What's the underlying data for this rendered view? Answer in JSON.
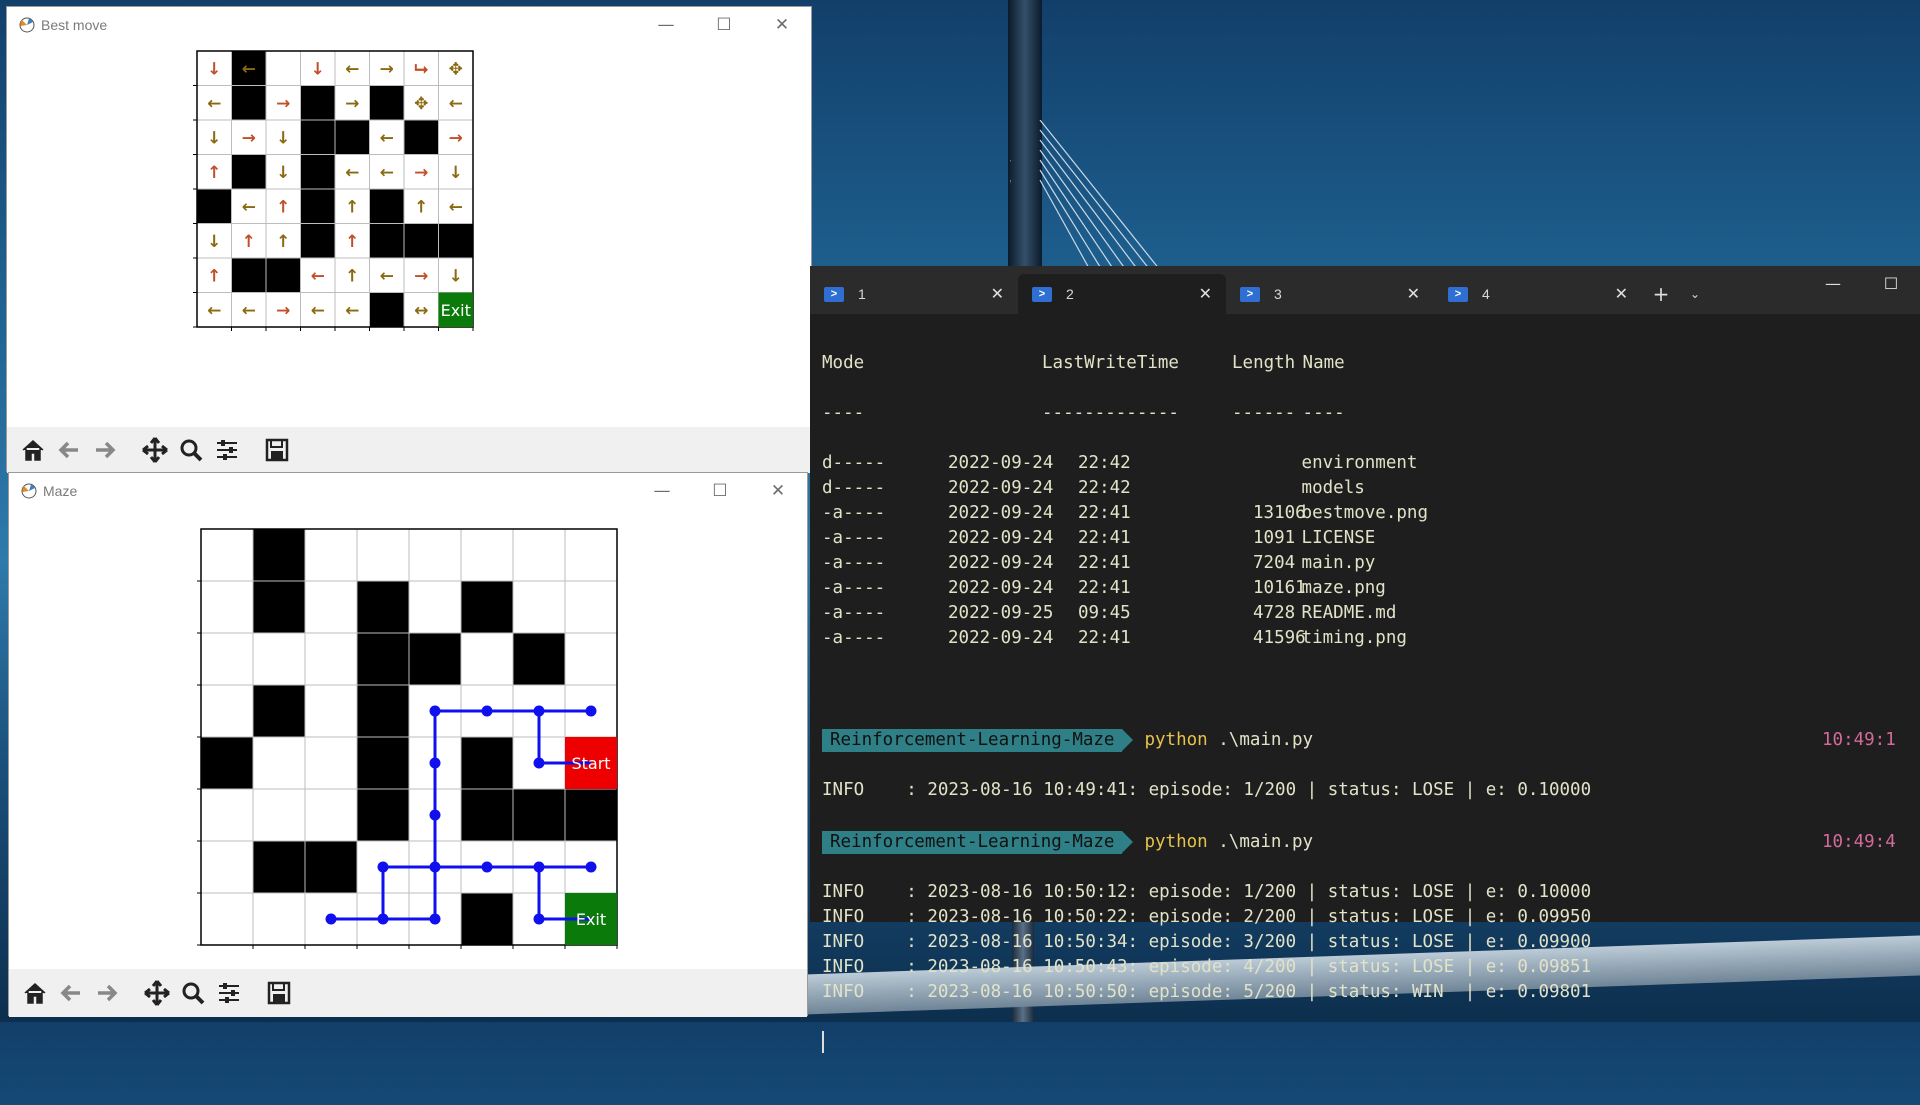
{
  "bestmove_window": {
    "title": "Best move",
    "exit_label": "Exit",
    "walls": [
      [
        0,
        1
      ],
      [
        1,
        1
      ],
      [
        1,
        3
      ],
      [
        1,
        5
      ],
      [
        2,
        3
      ],
      [
        2,
        4
      ],
      [
        2,
        6
      ],
      [
        3,
        1
      ],
      [
        3,
        3
      ],
      [
        4,
        0
      ],
      [
        4,
        3
      ],
      [
        4,
        5
      ],
      [
        5,
        3
      ],
      [
        5,
        5
      ],
      [
        5,
        6
      ],
      [
        5,
        7
      ],
      [
        6,
        1
      ],
      [
        6,
        2
      ],
      [
        7,
        5
      ]
    ],
    "arrows": [
      [
        "↓",
        "←",
        null,
        "↓",
        "←",
        "→",
        "⮡",
        "✥",
        "←"
      ],
      [
        "←",
        null,
        "→",
        null,
        "→",
        null,
        "✥",
        "←"
      ],
      [
        "↓",
        "→",
        "↓",
        null,
        null,
        "←",
        null,
        "→"
      ],
      [
        "↑",
        null,
        "↓",
        null,
        "←",
        "←",
        "→",
        "↓"
      ],
      [
        null,
        "←",
        "↑",
        null,
        "↑",
        null,
        "↑",
        "←"
      ],
      [
        "↓",
        "↑",
        "↑",
        null,
        "↑",
        null,
        null,
        null
      ],
      [
        "↑",
        null,
        null,
        "←",
        "↑",
        "←",
        "→",
        "↓"
      ],
      [
        "←",
        "←",
        "→",
        "←",
        "←",
        null,
        "↔",
        ""
      ]
    ]
  },
  "maze_window": {
    "title": "Maze",
    "start_label": "Start",
    "exit_label": "Exit",
    "walls": [
      [
        0,
        1
      ],
      [
        1,
        1
      ],
      [
        1,
        3
      ],
      [
        1,
        5
      ],
      [
        2,
        3
      ],
      [
        2,
        4
      ],
      [
        2,
        6
      ],
      [
        3,
        1
      ],
      [
        3,
        3
      ],
      [
        4,
        0
      ],
      [
        4,
        3
      ],
      [
        4,
        5
      ],
      [
        5,
        3
      ],
      [
        5,
        5
      ],
      [
        5,
        6
      ],
      [
        5,
        7
      ],
      [
        6,
        1
      ],
      [
        6,
        2
      ],
      [
        7,
        5
      ]
    ]
  },
  "toolbar": {
    "home_icon": "home-icon",
    "back_icon": "back-icon",
    "forward_icon": "forward-icon",
    "pan_icon": "pan-icon",
    "zoom_icon": "zoom-icon",
    "config_icon": "configure-subplots-icon",
    "save_icon": "save-icon"
  },
  "terminal": {
    "tabs": [
      {
        "label": "1"
      },
      {
        "label": "2"
      },
      {
        "label": "3"
      },
      {
        "label": "4"
      }
    ],
    "header": {
      "mode": "Mode",
      "time": "LastWriteTime",
      "length": "Length",
      "name": "Name"
    },
    "underline": {
      "mode": "----",
      "time": "-------------",
      "length": "------",
      "name": "----"
    },
    "files": [
      {
        "mode": "d-----",
        "date": "2022-09-24",
        "time": "22:42",
        "length": "",
        "name": "environment"
      },
      {
        "mode": "d-----",
        "date": "2022-09-24",
        "time": "22:42",
        "length": "",
        "name": "models"
      },
      {
        "mode": "-a----",
        "date": "2022-09-24",
        "time": "22:41",
        "length": "13106",
        "name": "bestmove.png"
      },
      {
        "mode": "-a----",
        "date": "2022-09-24",
        "time": "22:41",
        "length": "1091",
        "name": "LICENSE"
      },
      {
        "mode": "-a----",
        "date": "2022-09-24",
        "time": "22:41",
        "length": "7204",
        "name": "main.py"
      },
      {
        "mode": "-a----",
        "date": "2022-09-24",
        "time": "22:41",
        "length": "10161",
        "name": "maze.png"
      },
      {
        "mode": "-a----",
        "date": "2022-09-25",
        "time": "09:45",
        "length": "4728",
        "name": "README.md"
      },
      {
        "mode": "-a----",
        "date": "2022-09-24",
        "time": "22:41",
        "length": "41596",
        "name": "timing.png"
      }
    ],
    "prompt1": {
      "dir": "Reinforcement-Learning-Maze",
      "cmd": "python",
      "arg": ".\\main.py",
      "time": "10:49:1"
    },
    "log1": "INFO    : 2023-08-16 10:49:41: episode: 1/200 | status: LOSE | e: 0.10000",
    "prompt2": {
      "dir": "Reinforcement-Learning-Maze",
      "cmd": "python",
      "arg": ".\\main.py",
      "time": "10:49:4"
    },
    "logs": [
      "INFO    : 2023-08-16 10:50:12: episode: 1/200 | status: LOSE | e: 0.10000",
      "INFO    : 2023-08-16 10:50:22: episode: 2/200 | status: LOSE | e: 0.09950",
      "INFO    : 2023-08-16 10:50:34: episode: 3/200 | status: LOSE | e: 0.09900",
      "INFO    : 2023-08-16 10:50:43: episode: 4/200 | status: LOSE | e: 0.09851",
      "INFO    : 2023-08-16 10:50:50: episode: 5/200 | status: WIN  | e: 0.09801"
    ]
  }
}
